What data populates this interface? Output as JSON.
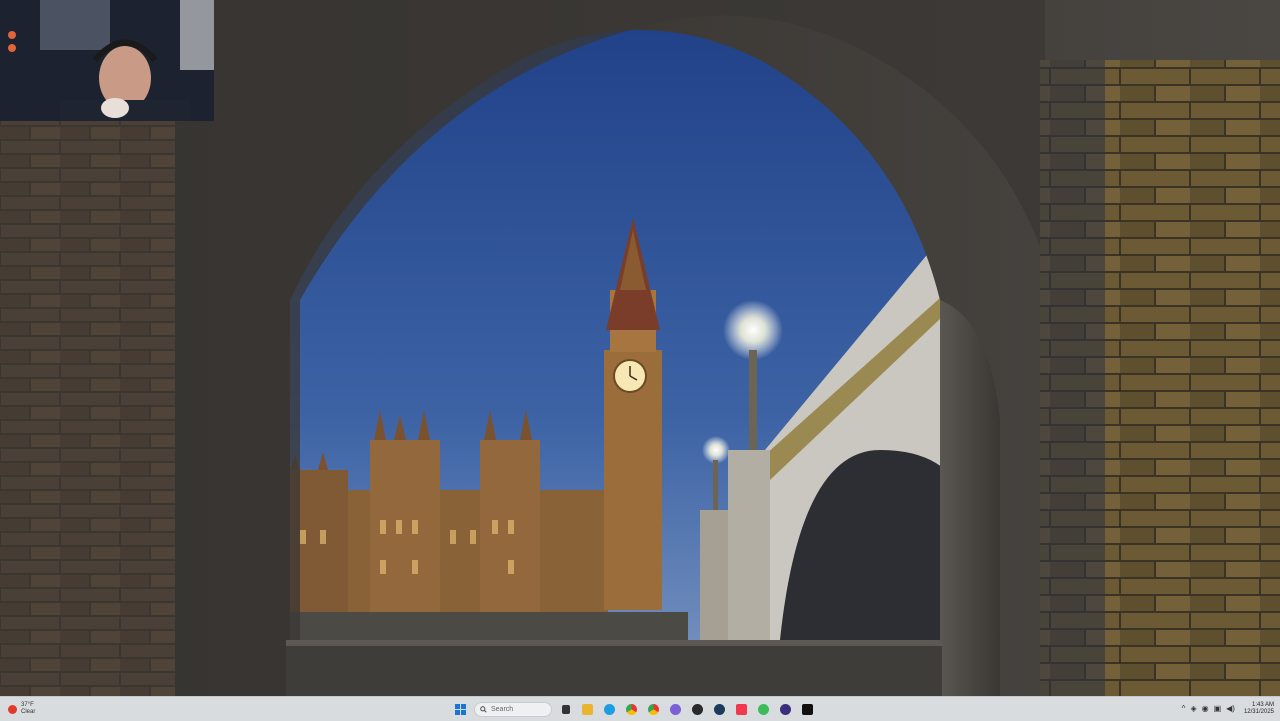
{
  "weather": {
    "temp": "37°F",
    "condition": "Clear",
    "icon": "sun-icon"
  },
  "taskbar": {
    "search_placeholder": "Search",
    "apps": [
      "file-explorer-icon",
      "folder-icon",
      "edge-icon",
      "chrome-icon",
      "chrome-alt-icon",
      "chrome-profile-icon",
      "app-icon",
      "steam-icon",
      "music-icon",
      "whatsapp-icon",
      "obs-icon",
      "capcut-icon"
    ]
  },
  "clock": {
    "time": "1:43 AM",
    "date": "12/31/2025"
  },
  "colors": {
    "sky_top": "#2b4a8f",
    "sky_bottom": "#5d7fb6",
    "stone": "#3e3b38",
    "brick": "#5a4a3a",
    "taskbar": "#d9dcdf"
  }
}
